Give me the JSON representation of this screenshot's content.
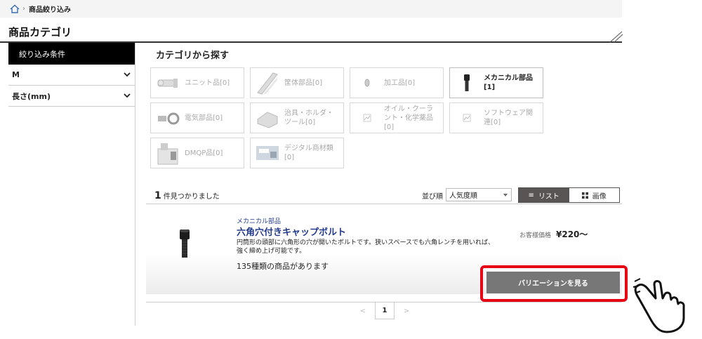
{
  "breadcrumb": {
    "current": "商品絞り込み"
  },
  "page_title": "商品カテゴリ",
  "sidebar": {
    "header": "絞り込み条件",
    "filters": [
      {
        "label": "M"
      },
      {
        "label": "長さ(mm)"
      }
    ]
  },
  "categories": {
    "title": "カテゴリから探す",
    "items": [
      {
        "label": "ユニット品[0]",
        "icon": "unit-parts-icon",
        "active": false
      },
      {
        "label": "筐体部品[0]",
        "icon": "frame-parts-icon",
        "active": false
      },
      {
        "label": "加工品[0]",
        "icon": "machined-parts-icon",
        "active": false
      },
      {
        "label": "メカニカル部品[1]",
        "icon": "mechanical-parts-icon",
        "active": true
      },
      {
        "label": "電気部品[0]",
        "icon": "electrical-parts-icon",
        "active": false
      },
      {
        "label": "治具・ホルダ・ツール[0]",
        "icon": "jig-holder-icon",
        "active": false
      },
      {
        "label": "オイル・クーラント・化学薬品[0]",
        "icon": "broken-image-icon",
        "active": false
      },
      {
        "label": "ソフトウェア関連[0]",
        "icon": "broken-image-icon",
        "active": false
      },
      {
        "label": "DMQP品[0]",
        "icon": "dmqp-icon",
        "active": false
      },
      {
        "label": "デジタル商材類[0]",
        "icon": "digital-goods-icon",
        "active": false
      }
    ]
  },
  "results": {
    "count": "1",
    "count_suffix": "件見つかりました",
    "sort_label": "並び順",
    "sort_value": "人気度順",
    "view_list": "リスト",
    "view_grid": "画像"
  },
  "product": {
    "category": "メカニカル部品",
    "name": "六角穴付きキャップボルト",
    "description": "円筒形の頭部に六角形の穴が開いたボルトです。狭いスペースでも六角レンチを用いれば、強く締め上げ可能です。",
    "variants": "135種類の商品があります",
    "price_label": "お客様価格",
    "price": "¥220〜",
    "button": "バリエーションを見る"
  },
  "pagination": {
    "prev": "<",
    "current": "1",
    "next": ">"
  },
  "colors": {
    "highlight": "#e60012",
    "link": "#223a8c",
    "button": "#777777"
  }
}
